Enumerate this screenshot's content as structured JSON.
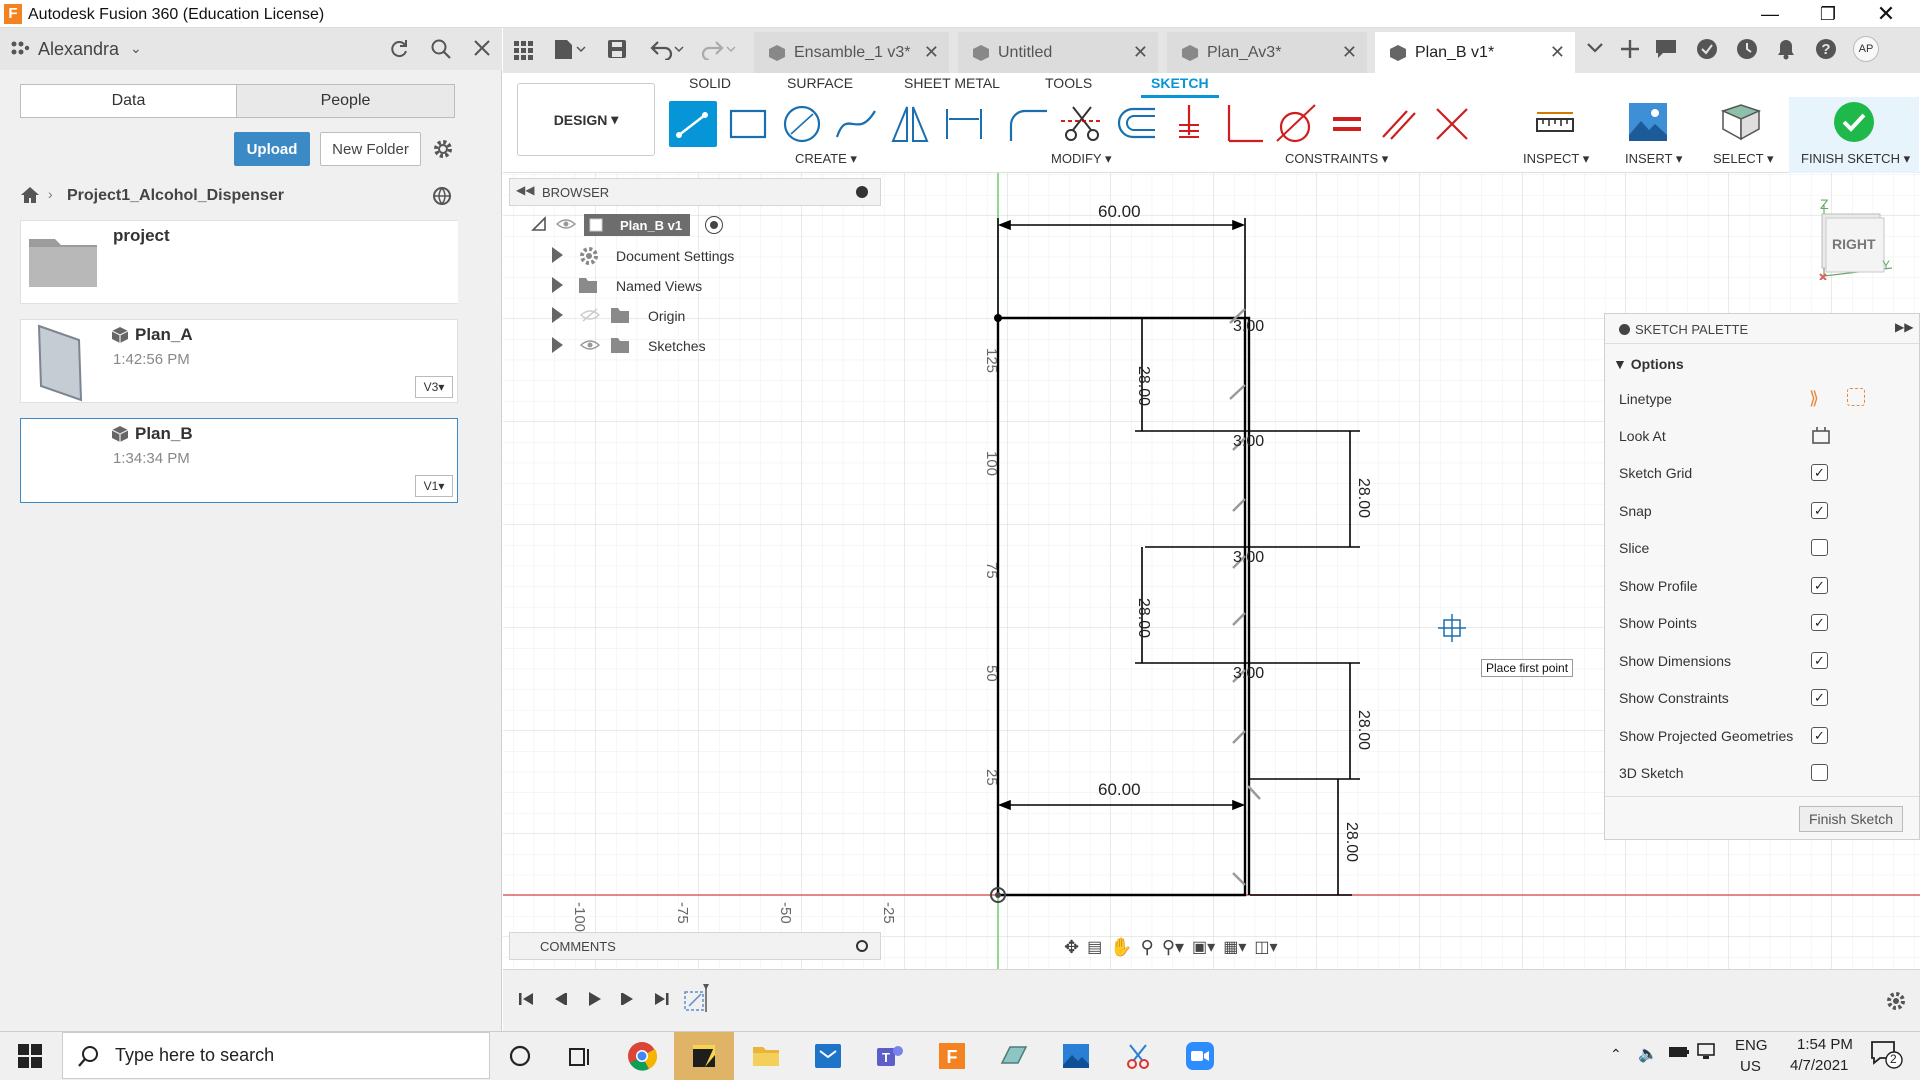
{
  "window": {
    "title": "Autodesk Fusion 360 (Education License)",
    "app_badge": "F"
  },
  "user": {
    "name": "Alexandra",
    "avatar_initials": "AP"
  },
  "data_panel": {
    "tabs": {
      "data": "Data",
      "people": "People"
    },
    "upload_label": "Upload",
    "new_folder_label": "New Folder",
    "breadcrumb": "Project1_Alcohol_Dispenser",
    "items": [
      {
        "name": "project",
        "time": "",
        "version": ""
      },
      {
        "name": "Plan_A",
        "time": "1:42:56 PM",
        "version": "V3"
      },
      {
        "name": "Plan_B",
        "time": "1:34:34 PM",
        "version": "V1"
      }
    ]
  },
  "doc_tabs": [
    "Ensamble_1 v3*",
    "Untitled",
    "Plan_Av3*",
    "Plan_B v1*"
  ],
  "toolbar": {
    "workspace": "DESIGN",
    "tabs": [
      "SOLID",
      "SURFACE",
      "SHEET METAL",
      "TOOLS",
      "SKETCH"
    ],
    "groups": {
      "create": "CREATE",
      "modify": "MODIFY",
      "constraints": "CONSTRAINTS",
      "inspect": "INSPECT",
      "insert": "INSERT",
      "select": "SELECT",
      "finish": "FINISH SKETCH"
    },
    "accent": "#0696d7",
    "finish_color": "#1fb84b"
  },
  "browser": {
    "title": "BROWSER",
    "root": "Plan_B v1",
    "items": [
      "Document Settings",
      "Named Views",
      "Origin",
      "Sketches"
    ]
  },
  "comments": {
    "title": "COMMENTS"
  },
  "viewcube": {
    "face": "RIGHT",
    "z": "Z",
    "y": "Y"
  },
  "sketch": {
    "dims": {
      "top_width": "60.00",
      "bottom_width": "60.00",
      "gap1": "3.00",
      "gap2": "3.00",
      "gap3": "3.00",
      "gap4": "3.00",
      "h1": "28.00",
      "h2": "28.00",
      "h3": "28.00",
      "h4": "28.00",
      "h5": "28.00"
    },
    "vertical_ticks": [
      "125",
      "100",
      "75",
      "50",
      "25"
    ],
    "horizontal_ticks": [
      "-100",
      "-75",
      "-50",
      "-25"
    ],
    "tooltip": "Place first point"
  },
  "palette": {
    "title": "SKETCH PALETTE",
    "section": "Options",
    "rows": [
      {
        "label": "Linetype",
        "type": "icons"
      },
      {
        "label": "Look At",
        "type": "icon"
      },
      {
        "label": "Sketch Grid",
        "type": "check",
        "checked": true
      },
      {
        "label": "Snap",
        "type": "check",
        "checked": true
      },
      {
        "label": "Slice",
        "type": "check",
        "checked": false
      },
      {
        "label": "Show Profile",
        "type": "check",
        "checked": true
      },
      {
        "label": "Show Points",
        "type": "check",
        "checked": true
      },
      {
        "label": "Show Dimensions",
        "type": "check",
        "checked": true
      },
      {
        "label": "Show Constraints",
        "type": "check",
        "checked": true
      },
      {
        "label": "Show Projected Geometries",
        "type": "check",
        "checked": true
      },
      {
        "label": "3D Sketch",
        "type": "check",
        "checked": false
      }
    ],
    "finish_label": "Finish Sketch"
  },
  "taskbar": {
    "search_placeholder": "Type here to search",
    "lang": "ENG",
    "region": "US",
    "time": "1:54 PM",
    "date": "4/7/2021",
    "notifications": "2"
  }
}
